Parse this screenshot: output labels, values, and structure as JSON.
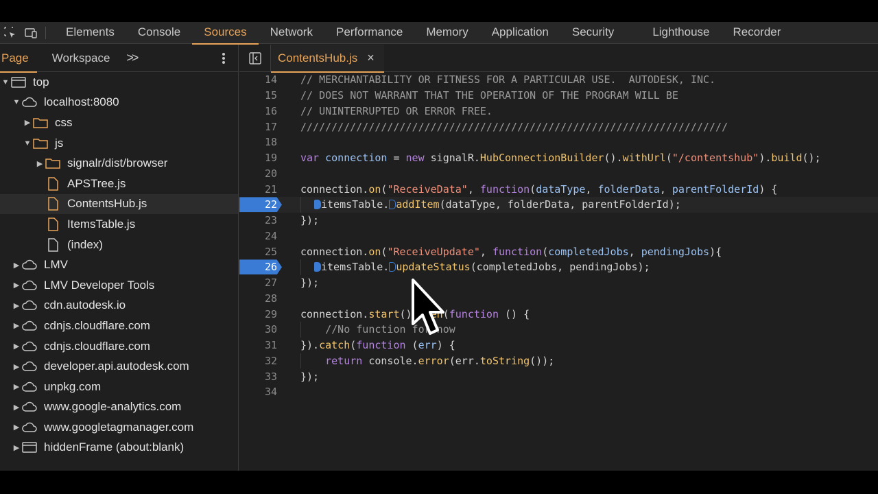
{
  "main_tabs": [
    "Elements",
    "Console",
    "Sources",
    "Network",
    "Performance",
    "Memory",
    "Application",
    "Security",
    "Lighthouse",
    "Recorder"
  ],
  "active_main_tab": "Sources",
  "navigator": {
    "tabs": [
      "Page",
      "Workspace"
    ],
    "more": ">>",
    "tree": [
      {
        "label": "top",
        "icon": "frame-icon",
        "arrow": "open",
        "indent": 0
      },
      {
        "label": "localhost:8080",
        "icon": "cloud-icon",
        "arrow": "open",
        "indent": 1
      },
      {
        "label": "css",
        "icon": "folder-icon",
        "arrow": "closed",
        "indent": 2
      },
      {
        "label": "js",
        "icon": "folder-icon",
        "arrow": "open",
        "indent": 2
      },
      {
        "label": "signalr/dist/browser",
        "icon": "folder-icon",
        "arrow": "closed",
        "indent": 3
      },
      {
        "label": "APSTree.js",
        "icon": "file-js-icon",
        "arrow": "none",
        "indent": 3
      },
      {
        "label": "ContentsHub.js",
        "icon": "file-js-icon",
        "arrow": "none",
        "indent": 3,
        "selected": true
      },
      {
        "label": "ItemsTable.js",
        "icon": "file-js-icon",
        "arrow": "none",
        "indent": 3
      },
      {
        "label": "(index)",
        "icon": "file-icon",
        "arrow": "none",
        "indent": 2
      },
      {
        "label": "LMV",
        "icon": "cloud-icon",
        "arrow": "closed",
        "indent": 1
      },
      {
        "label": "LMV Developer Tools",
        "icon": "cloud-icon",
        "arrow": "closed",
        "indent": 1
      },
      {
        "label": "cdn.autodesk.io",
        "icon": "cloud-icon",
        "arrow": "closed",
        "indent": 1
      },
      {
        "label": "cdnjs.cloudflare.com",
        "icon": "cloud-icon",
        "arrow": "closed",
        "indent": 1
      },
      {
        "label": "cdnjs.cloudflare.com",
        "icon": "cloud-icon",
        "arrow": "closed",
        "indent": 1
      },
      {
        "label": "developer.api.autodesk.com",
        "icon": "cloud-icon",
        "arrow": "closed",
        "indent": 1
      },
      {
        "label": "unpkg.com",
        "icon": "cloud-icon",
        "arrow": "closed",
        "indent": 1
      },
      {
        "label": "www.google-analytics.com",
        "icon": "cloud-icon",
        "arrow": "closed",
        "indent": 1
      },
      {
        "label": "www.googletagmanager.com",
        "icon": "cloud-icon",
        "arrow": "closed",
        "indent": 1
      },
      {
        "label": "hiddenFrame (about:blank)",
        "icon": "frame-icon",
        "arrow": "closed",
        "indent": 1
      }
    ]
  },
  "editor": {
    "file_tab": "ContentsHub.js",
    "close": "×",
    "lines": [
      {
        "n": "14",
        "tokens": [
          [
            "cm",
            "// MERCHANTABILITY OR FITNESS FOR A PARTICULAR USE.  AUTODESK, INC."
          ]
        ]
      },
      {
        "n": "15",
        "tokens": [
          [
            "cm",
            "// DOES NOT WARRANT THAT THE OPERATION OF THE PROGRAM WILL BE"
          ]
        ]
      },
      {
        "n": "16",
        "tokens": [
          [
            "cm",
            "// UNINTERRUPTED OR ERROR FREE."
          ]
        ]
      },
      {
        "n": "17",
        "tokens": [
          [
            "cm",
            "/////////////////////////////////////////////////////////////////////"
          ]
        ]
      },
      {
        "n": "18",
        "tokens": []
      },
      {
        "n": "19",
        "tokens": [
          [
            "kw",
            "var"
          ],
          [
            "pl",
            " "
          ],
          [
            "id",
            "connection"
          ],
          [
            "pl",
            " = "
          ],
          [
            "kw",
            "new"
          ],
          [
            "pl",
            " signalR."
          ],
          [
            "fn",
            "HubConnectionBuilder"
          ],
          [
            "pl",
            "()."
          ],
          [
            "fn",
            "withUrl"
          ],
          [
            "pl",
            "("
          ],
          [
            "str",
            "\"/contentshub\""
          ],
          [
            "pl",
            ")."
          ],
          [
            "fn",
            "build"
          ],
          [
            "pl",
            "();"
          ]
        ]
      },
      {
        "n": "20",
        "tokens": []
      },
      {
        "n": "21",
        "tokens": [
          [
            "pl",
            "connection."
          ],
          [
            "fn",
            "on"
          ],
          [
            "pl",
            "("
          ],
          [
            "str",
            "\"ReceiveData\""
          ],
          [
            "pl",
            ", "
          ],
          [
            "kw",
            "function"
          ],
          [
            "pl",
            "("
          ],
          [
            "pm",
            "dataType"
          ],
          [
            "pl",
            ", "
          ],
          [
            "pm",
            "folderData"
          ],
          [
            "pl",
            ", "
          ],
          [
            "pm",
            "parentFolderId"
          ],
          [
            "pl",
            ") {"
          ]
        ]
      },
      {
        "n": "22",
        "bp": true,
        "hl": true,
        "guide": true,
        "tokens": [
          [
            "mk",
            "filled"
          ],
          [
            "pl",
            "itemsTable."
          ],
          [
            "mk",
            "outline"
          ],
          [
            "fn",
            "addItem"
          ],
          [
            "pl",
            "(dataType, folderData, parentFolderId);"
          ]
        ]
      },
      {
        "n": "23",
        "tokens": [
          [
            "pl",
            "});"
          ]
        ]
      },
      {
        "n": "24",
        "tokens": []
      },
      {
        "n": "25",
        "tokens": [
          [
            "pl",
            "connection."
          ],
          [
            "fn",
            "on"
          ],
          [
            "pl",
            "("
          ],
          [
            "str",
            "\"ReceiveUpdate\""
          ],
          [
            "pl",
            ", "
          ],
          [
            "kw",
            "function"
          ],
          [
            "pl",
            "("
          ],
          [
            "pm",
            "completedJobs"
          ],
          [
            "pl",
            ", "
          ],
          [
            "pm",
            "pendingJobs"
          ],
          [
            "pl",
            "){"
          ]
        ]
      },
      {
        "n": "26",
        "bp": true,
        "guide": true,
        "tokens": [
          [
            "mk",
            "filled"
          ],
          [
            "pl",
            "itemsTable."
          ],
          [
            "mk",
            "outline"
          ],
          [
            "fn",
            "updateStatus"
          ],
          [
            "pl",
            "(completedJobs, pendingJobs);"
          ]
        ]
      },
      {
        "n": "27",
        "tokens": [
          [
            "pl",
            "});"
          ]
        ]
      },
      {
        "n": "28",
        "tokens": []
      },
      {
        "n": "29",
        "tokens": [
          [
            "pl",
            "connection."
          ],
          [
            "fn",
            "start"
          ],
          [
            "pl",
            "()."
          ],
          [
            "fn",
            "then"
          ],
          [
            "pl",
            "("
          ],
          [
            "kw",
            "function"
          ],
          [
            "pl",
            " () {"
          ]
        ]
      },
      {
        "n": "30",
        "guide": true,
        "tokens": [
          [
            "cm",
            "    //No function for now"
          ]
        ]
      },
      {
        "n": "31",
        "tokens": [
          [
            "pl",
            "})."
          ],
          [
            "fn",
            "catch"
          ],
          [
            "pl",
            "("
          ],
          [
            "kw",
            "function"
          ],
          [
            "pl",
            " ("
          ],
          [
            "pm",
            "err"
          ],
          [
            "pl",
            ") {"
          ]
        ]
      },
      {
        "n": "32",
        "guide": true,
        "tokens": [
          [
            "pl",
            "    "
          ],
          [
            "kw",
            "return"
          ],
          [
            "pl",
            " console."
          ],
          [
            "fn",
            "error"
          ],
          [
            "pl",
            "(err."
          ],
          [
            "fn",
            "toString"
          ],
          [
            "pl",
            "());"
          ]
        ]
      },
      {
        "n": "33",
        "tokens": [
          [
            "pl",
            "});"
          ]
        ]
      },
      {
        "n": "34",
        "tokens": []
      }
    ]
  }
}
